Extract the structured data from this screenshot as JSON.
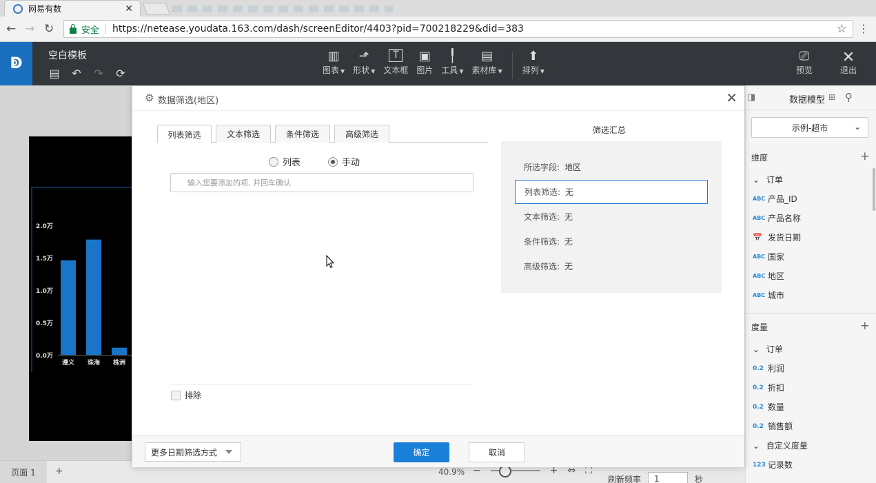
{
  "browser": {
    "tab_title": "网易有数",
    "tab_close": "✕",
    "secure_label": "安全",
    "url": "https://netease.youdata.163.com/dash/screenEditor/4403?pid=700218229&did=383"
  },
  "app": {
    "doc_title": "空白模板",
    "toolbar": [
      {
        "label": "图表",
        "icon": "bar-chart-icon",
        "glyph": "▥",
        "dropdown": true
      },
      {
        "label": "形状",
        "icon": "shape-icon",
        "glyph": "⬏",
        "dropdown": true
      },
      {
        "label": "文本框",
        "icon": "textbox-icon",
        "glyph": "T",
        "dropdown": false
      },
      {
        "label": "图片",
        "icon": "image-icon",
        "glyph": "▣",
        "dropdown": false
      },
      {
        "label": "工具",
        "icon": "tool-icon",
        "glyph": "╿",
        "dropdown": true
      },
      {
        "label": "素材库",
        "icon": "library-icon",
        "glyph": "▤",
        "dropdown": true
      },
      {
        "label": "排列",
        "icon": "arrange-icon",
        "glyph": "⬆",
        "dropdown": true
      }
    ],
    "preview_label": "预览",
    "exit_label": "退出"
  },
  "chart_data": {
    "type": "bar",
    "categories": [
      "遵义",
      "珠海",
      "株洲"
    ],
    "values": [
      14600,
      17800,
      1100
    ],
    "ytick_labels": [
      "0.0万",
      "0.5万",
      "1.0万",
      "1.5万",
      "2.0万"
    ],
    "ylim": [
      0,
      20000
    ],
    "bar_color": "#1a75c8",
    "background": "#000000"
  },
  "bottom": {
    "page_tab": "页面 1",
    "add_page": "+",
    "zoom": "40.9%",
    "refresh_label": "刷新频率",
    "refresh_value": "1",
    "refresh_unit": "秒"
  },
  "right_panel": {
    "title": "数据模型",
    "model_select": "示例-超市",
    "dimension_label": "维度",
    "dimension_group": "订单",
    "dimensions": [
      {
        "type": "ABC",
        "name": "产品_ID"
      },
      {
        "type": "ABC",
        "name": "产品名称"
      },
      {
        "type": "DATE",
        "name": "发货日期"
      },
      {
        "type": "ABC",
        "name": "国家"
      },
      {
        "type": "ABC",
        "name": "地区"
      },
      {
        "type": "ABC",
        "name": "城市"
      }
    ],
    "measure_label": "度量",
    "measure_group": "订单",
    "measures": [
      {
        "type": "0.2",
        "name": "利润"
      },
      {
        "type": "0.2",
        "name": "折扣"
      },
      {
        "type": "0.2",
        "name": "数量"
      },
      {
        "type": "0.2",
        "name": "销售额"
      }
    ],
    "custom_measure_group": "自定义度量",
    "custom_measures": [
      {
        "type": "123",
        "name": "记录数"
      }
    ]
  },
  "modal": {
    "title": "数据筛选(地区)",
    "tabs": [
      "列表筛选",
      "文本筛选",
      "条件筛选",
      "高级筛选"
    ],
    "radio_list": "列表",
    "radio_manual": "手动",
    "input_placeholder": "输入您要添加的项, 并回车确认",
    "exclude_label": "排除",
    "summary_title": "筛选汇总",
    "summary_rows": [
      {
        "key": "所选字段:",
        "value": "地区"
      },
      {
        "key": "列表筛选:",
        "value": "无"
      },
      {
        "key": "文本筛选:",
        "value": "无"
      },
      {
        "key": "条件筛选:",
        "value": "无"
      },
      {
        "key": "高级筛选:",
        "value": "无"
      }
    ],
    "date_filter_label": "更多日期筛选方式",
    "ok_label": "确定",
    "cancel_label": "取消"
  }
}
